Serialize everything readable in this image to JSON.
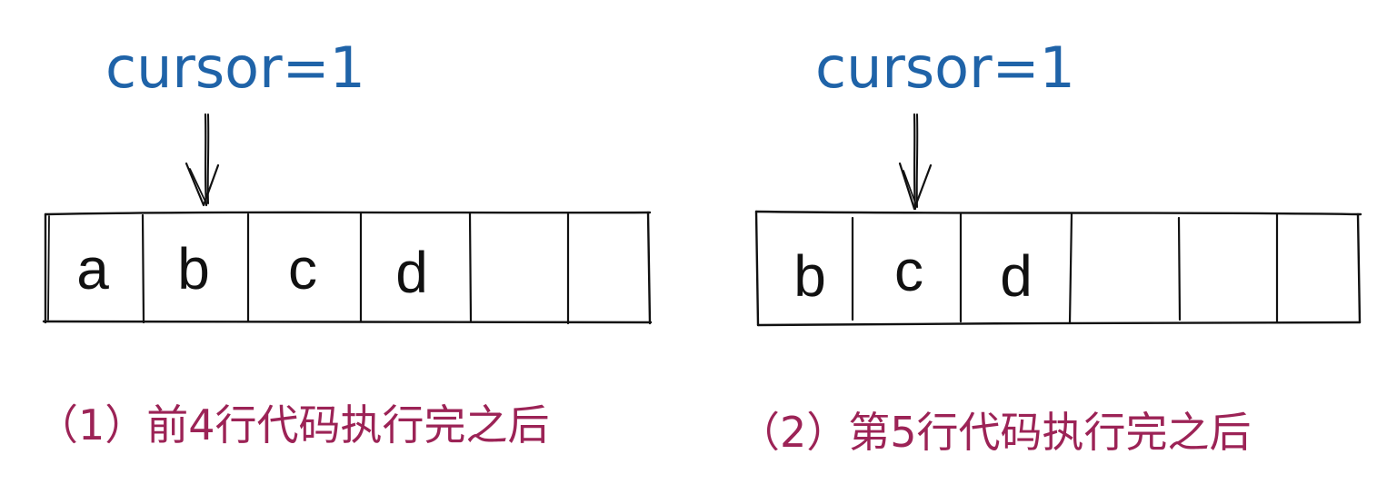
{
  "colors": {
    "cursor_label": "#1f63a8",
    "caption": "#9c2356",
    "ink": "#111111"
  },
  "panels": [
    {
      "cursor_label": "cursor=1",
      "cells": [
        "a",
        "b",
        "c",
        "d",
        "",
        ""
      ],
      "cursor_index": 1,
      "caption": "（1）前4行代码执行完之后"
    },
    {
      "cursor_label": "cursor=1",
      "cells": [
        "b",
        "c",
        "d",
        "",
        "",
        ""
      ],
      "cursor_index": 1,
      "caption": "（2）第5行代码执行完之后"
    }
  ]
}
